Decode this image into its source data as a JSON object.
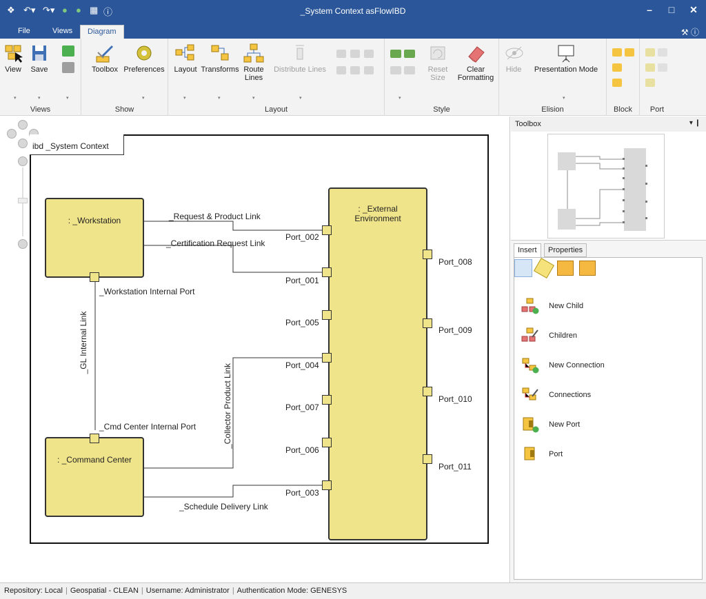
{
  "window": {
    "title": "_System Context asFlowIBD"
  },
  "ribbon_tabs": [
    {
      "label": "File"
    },
    {
      "label": "Views"
    },
    {
      "label": "Diagram"
    }
  ],
  "ribbon": {
    "views": {
      "label": "Views",
      "view": "View",
      "save": "Save"
    },
    "show": {
      "label": "Show",
      "toolbox": "Toolbox",
      "preferences": "Preferences"
    },
    "layout": {
      "label": "Layout",
      "layout": "Layout",
      "transforms": "Transforms",
      "route_lines": "Route Lines",
      "distribute_lines": "Distribute Lines"
    },
    "style": {
      "label": "Style",
      "reset_size": "Reset Size",
      "clear_formatting": "Clear Formatting"
    },
    "elision": {
      "label": "Elision",
      "hide": "Hide",
      "presentation_mode": "Presentation Mode"
    },
    "block": {
      "label": "Block"
    },
    "port": {
      "label": "Port"
    }
  },
  "diagram": {
    "frame_label": "ibd _System Context",
    "blocks": {
      "workstation": ": _Workstation",
      "command_center": ": _Command Center",
      "external_env": ": _External Environment"
    },
    "ports": {
      "p002": "Port_002",
      "p001": "Port_001",
      "p005": "Port_005",
      "p004": "Port_004",
      "p007": "Port_007",
      "p006": "Port_006",
      "p003": "Port_003",
      "p008": "Port_008",
      "p009": "Port_009",
      "p010": "Port_010",
      "p011": "Port_011",
      "ws_internal": "_Workstation Internal Port",
      "cmd_internal": "_Cmd Center Internal Port"
    },
    "links": {
      "request_product": "_Request & Product Link",
      "cert_request": "_Certification Request Link",
      "gl_internal": "_GL Internal Link",
      "collector_product": "_Collector Product Link",
      "schedule_delivery": "_Schedule Delivery Link"
    }
  },
  "toolbox_panel": {
    "title": "Toolbox"
  },
  "insert_panel": {
    "tabs": [
      {
        "label": "Insert"
      },
      {
        "label": "Properties"
      }
    ],
    "commands": [
      {
        "label": "New Child"
      },
      {
        "label": "Children"
      },
      {
        "label": "New Connection"
      },
      {
        "label": "Connections"
      },
      {
        "label": "New Port"
      },
      {
        "label": "Port"
      }
    ]
  },
  "status": {
    "repository": "Repository: Local",
    "project": "Geospatial - CLEAN",
    "username": "Username: Administrator",
    "auth": "Authentication Mode: GENESYS"
  }
}
